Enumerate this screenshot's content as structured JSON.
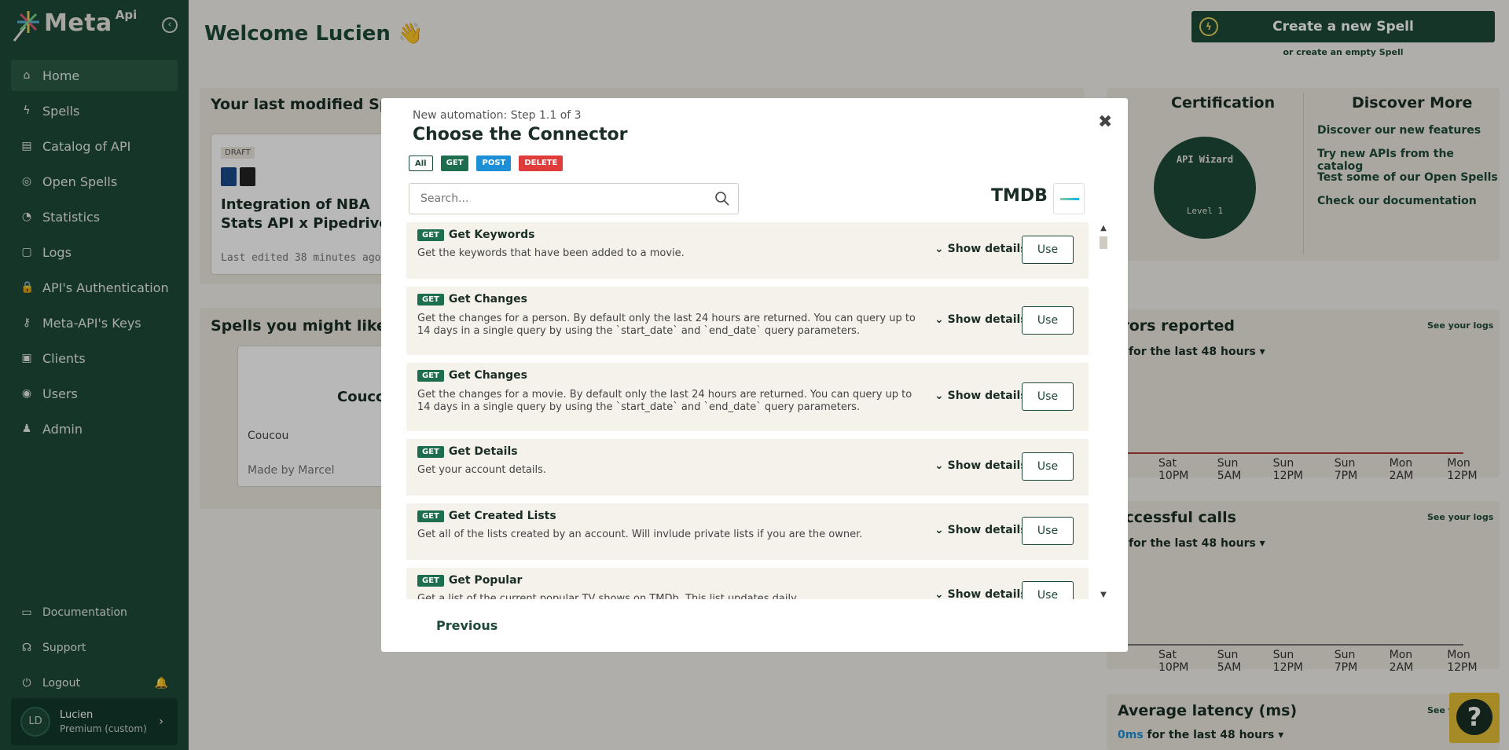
{
  "brand": {
    "name": "Meta",
    "suffix": "Api"
  },
  "nav": [
    {
      "label": "Home",
      "icon": "home-icon",
      "glyph": "⌂"
    },
    {
      "label": "Spells",
      "icon": "lightning-icon",
      "glyph": "ϟ"
    },
    {
      "label": "Catalog of API",
      "icon": "book-icon",
      "glyph": "▤"
    },
    {
      "label": "Open Spells",
      "icon": "globe-icon",
      "glyph": "◎"
    },
    {
      "label": "Statistics",
      "icon": "pie-chart-icon",
      "glyph": "◔"
    },
    {
      "label": "Logs",
      "icon": "logs-icon",
      "glyph": "▢"
    },
    {
      "label": "API's Authentication",
      "icon": "lock-icon",
      "glyph": "🔒"
    },
    {
      "label": "Meta-API's Keys",
      "icon": "key-icon",
      "glyph": "⚷"
    },
    {
      "label": "Clients",
      "icon": "briefcase-icon",
      "glyph": "▣"
    },
    {
      "label": "Users",
      "icon": "users-icon",
      "glyph": "◉"
    },
    {
      "label": "Admin",
      "icon": "admin-icon",
      "glyph": "♟"
    }
  ],
  "bottom_nav": [
    {
      "label": "Documentation",
      "icon": "documentation-icon",
      "glyph": "▭"
    },
    {
      "label": "Support",
      "icon": "support-icon",
      "glyph": "☊"
    },
    {
      "label": "Logout",
      "icon": "logout-icon",
      "glyph": "⏻"
    }
  ],
  "user": {
    "initials": "LD",
    "name": "Lucien",
    "plan": "Premium (custom)"
  },
  "main": {
    "welcome": "Welcome Lucien 👋",
    "create_button": "Create a new Spell",
    "create_empty": "or create an empty Spell",
    "last_modified_title": "Your last modified Spells",
    "draft_label": "DRAFT",
    "spell_card_title": "Integration of NBA Stats API x Pipedrive",
    "spell_card_meta": "Last edited 38 minutes ago",
    "might_like_title": "Spells you might like",
    "like_card_title": "Couco",
    "like_card_desc": "Coucou",
    "like_card_author": "Made by Marcel",
    "certification_title": "Certification",
    "wizard_badge_top": "API Wizard",
    "wizard_badge_level": "Level 1",
    "discover_title": "Discover More",
    "discover_links": [
      "Discover our new features",
      "Try new APIs from the catalog",
      "Test some of our Open Spells",
      "Check our documentation"
    ],
    "errors_title": "rrors reported",
    "success_title": "uccessful calls",
    "latency_title": "Average latency (ms)",
    "see_logs": "See your logs",
    "see_logs_partial": "See y",
    "period": "for the last 48 hours",
    "latency_value": "0ms",
    "axis_labels": [
      "Sat 10PM",
      "Sun 5AM",
      "Sun 12PM",
      "Sun 7PM",
      "Mon 2AM",
      "Mon 12PM"
    ],
    "help_glyph": "?"
  },
  "modal": {
    "step": "New automation: Step 1.1 of 3",
    "title": "Choose the Connector",
    "close_glyph": "✖",
    "filters": {
      "all": "All",
      "get": "GET",
      "post": "POST",
      "delete": "DELETE"
    },
    "search_placeholder": "Search...",
    "connector_name": "TMDB",
    "method_label": "GET",
    "show_details": "Show details",
    "use_label": "Use",
    "previous": "Previous",
    "items": [
      {
        "title": "Get Keywords",
        "desc": "Get the keywords that have been added to a movie."
      },
      {
        "title": "Get Changes",
        "desc": "Get the changes for a person. By default only the last 24 hours are returned. You can query up to 14 days in a single query by using the `start_date` and `end_date` query parameters."
      },
      {
        "title": "Get Changes",
        "desc": "Get the changes for a movie. By default only the last 24 hours are returned. You can query up to 14 days in a single query by using the `start_date` and `end_date` query parameters."
      },
      {
        "title": "Get Details",
        "desc": "Get your account details."
      },
      {
        "title": "Get Created Lists",
        "desc": "Get all of the lists created by an account. Will invlude private lists if you are the owner."
      },
      {
        "title": "Get Popular",
        "desc": "Get a list of the current popular TV shows on TMDb. This list updates daily."
      }
    ]
  },
  "colors": {
    "sidebar": "#1d4a38",
    "accent": "#1d4a38",
    "get": "#1d6e4f",
    "post": "#1d8fd6",
    "delete": "#e03c3c",
    "help": "#e6c034"
  }
}
